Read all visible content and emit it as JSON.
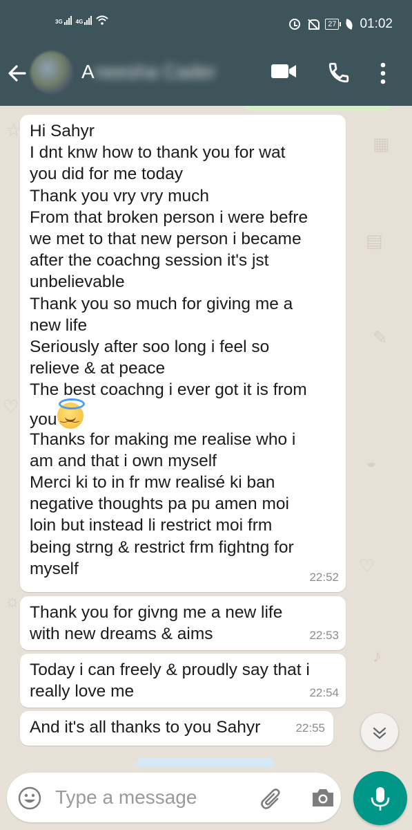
{
  "status_bar": {
    "network1": "3G",
    "network2": "4G",
    "battery": "27",
    "time": "01:02"
  },
  "header": {
    "contact_initial": "A",
    "contact_name_rest": "neesha Cader"
  },
  "messages": [
    {
      "lines": [
        "Hi Sahyr",
        "I dnt knw how to thank you for wat",
        "you did for me today",
        "Thank you vry vry much",
        "From that broken person i were befre",
        "we met to that new person i became",
        "after the coachng session it's jst",
        "unbelievable",
        "Thank you so much for giving me a",
        "new life",
        "Seriously after soo long i feel so",
        "relieve & at peace",
        "The best coachng i ever got it is from",
        "you",
        "Thanks for making me realise who i",
        "am and that i own myself",
        "Merci ki to in fr mw realisé ki ban",
        "negative thoughts pa pu amen moi",
        "loin but instead li restrict moi frm",
        "being strng & restrict frm fightng for",
        "myself"
      ],
      "time": "22:52"
    },
    {
      "lines": [
        "Thank you for givng me a new life",
        "with new dreams & aims"
      ],
      "time": "22:53"
    },
    {
      "lines": [
        "Today i can freely & proudly say that i",
        "really love me"
      ],
      "time": "22:54"
    },
    {
      "lines": [
        "And it's all thanks to you Sahyr"
      ],
      "time": "22:55"
    }
  ],
  "input": {
    "placeholder": "Type a message"
  },
  "icons": [
    "back-arrow-icon",
    "video-call-icon",
    "phone-call-icon",
    "more-menu-icon",
    "scroll-down-icon",
    "emoji-icon",
    "attach-icon",
    "camera-icon",
    "mic-icon"
  ],
  "colors": {
    "header": "#3e545b",
    "chat_bg": "#e6e0d6",
    "accent": "#009788"
  }
}
